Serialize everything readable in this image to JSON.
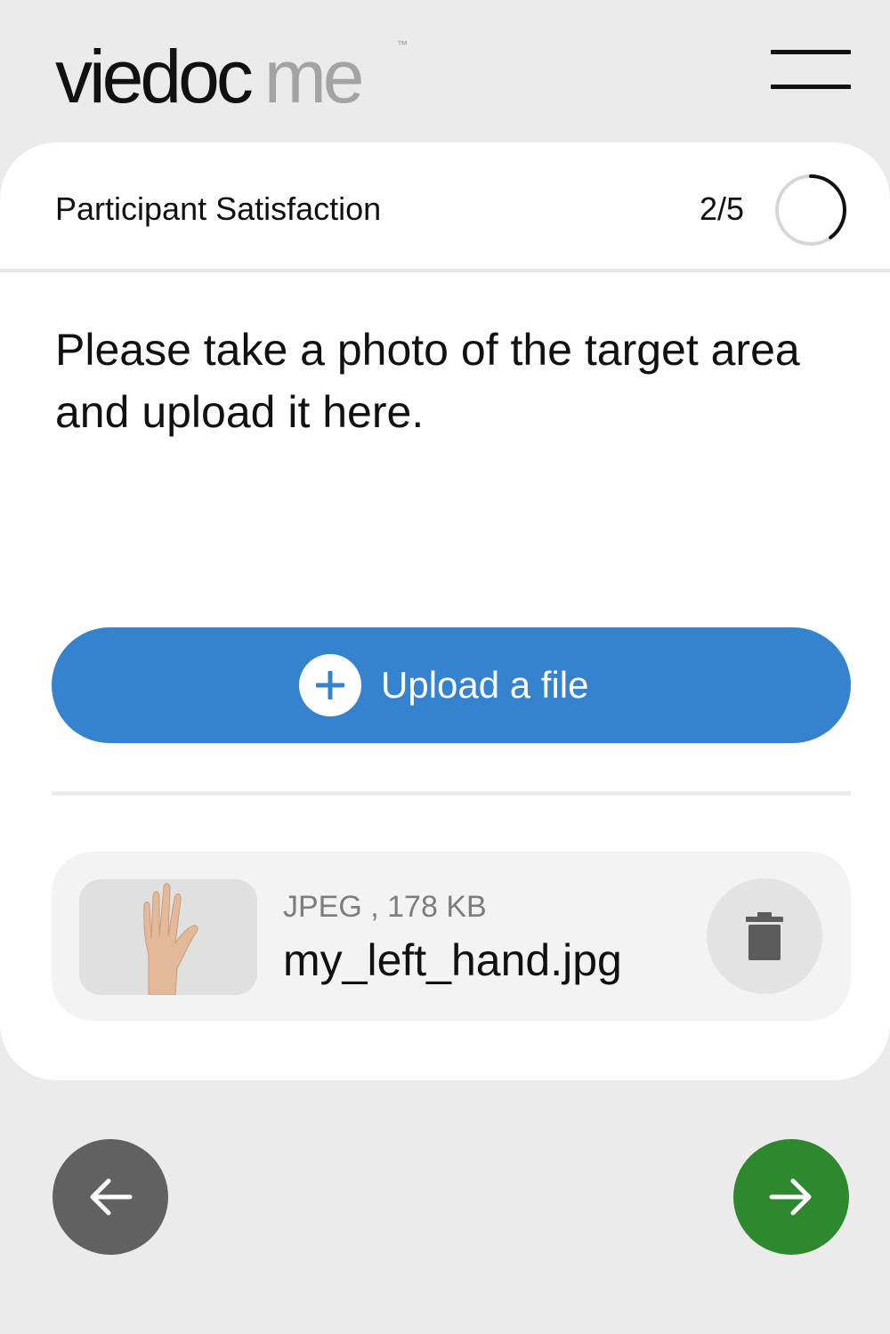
{
  "header": {
    "logo_brand": "viedoc",
    "logo_sub": "me",
    "logo_tm": "™",
    "menu_icon": "hamburger-menu-icon"
  },
  "form": {
    "title": "Participant Satisfaction",
    "progress_text": "2/5",
    "progress_fraction": 0.4
  },
  "question": {
    "text": "Please take a photo of the target area and upload it here."
  },
  "upload": {
    "label": "Upload a file",
    "icon": "plus-circle-icon",
    "color": "#3583ce"
  },
  "files": [
    {
      "meta": "JPEG , 178 KB",
      "name": "my_left_hand.jpg",
      "thumbnail_icon": "hand-photo-thumbnail",
      "delete_icon": "trash-icon"
    }
  ],
  "navigation": {
    "back_icon": "arrow-left-icon",
    "back_color": "#616161",
    "next_icon": "arrow-right-icon",
    "next_color": "#2e882e"
  }
}
